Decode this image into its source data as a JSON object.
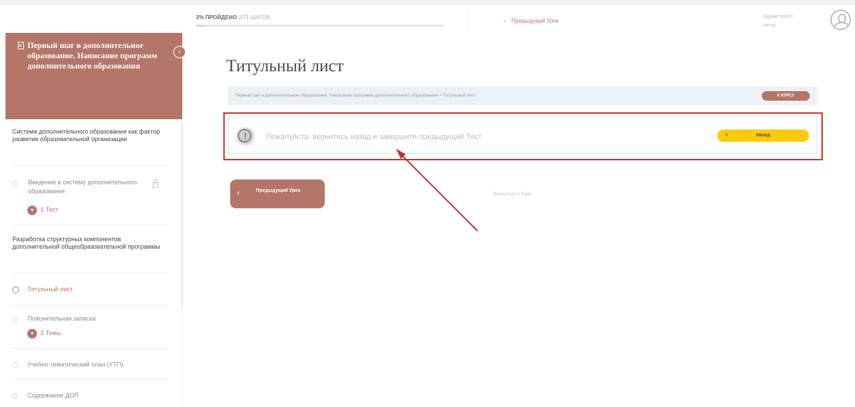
{
  "topbar": {
    "progress_bold": "3% ПРОЙДЕНО",
    "progress_rest": "2/71 ШАГОВ",
    "progress_percent": 3,
    "prev_lesson_label": "Предыдущий Урок",
    "user_name_line1": "Здравствуйте,",
    "user_name_line2": "Автор"
  },
  "sidebar": {
    "course_title": "Первый шаг в дополнительное образование. Написание программ дополнительного образования",
    "sections": [
      {
        "title": "Система дополнительного образования как фактор развития образовательной организации",
        "lessons": [
          {
            "label": "Введение в систему дополнительного образования",
            "badge_count": "1",
            "badge_text": "1 Тест"
          }
        ]
      },
      {
        "title": "Разработка структурных компонентов дополнительной общеобразовательной программы",
        "lessons": [
          {
            "label": "Титульный лист"
          },
          {
            "label": "Пояснительная записка",
            "badge_count": "2",
            "badge_text": "2 Темы"
          },
          {
            "label": "Учебно-тематический план (УТП)"
          },
          {
            "label": "Содержание ДОП"
          }
        ]
      }
    ]
  },
  "main": {
    "page_title": "Титульный лист",
    "breadcrumb": "Первый шаг в дополнительное образование. Написание программ дополнительного образования > Титульный лист",
    "course_button": "К КУРСУ",
    "notice_text": "Пожалуйста, вернитесь назад и завершите предыдущий Тест.",
    "back_button": "Назад",
    "prev_lesson_button": "Предыдущий Урок",
    "return_link": "Вернуться к Курс"
  },
  "colors": {
    "accent": "#b5766a",
    "warning_button": "#fccb11",
    "highlight": "#c4322a"
  }
}
